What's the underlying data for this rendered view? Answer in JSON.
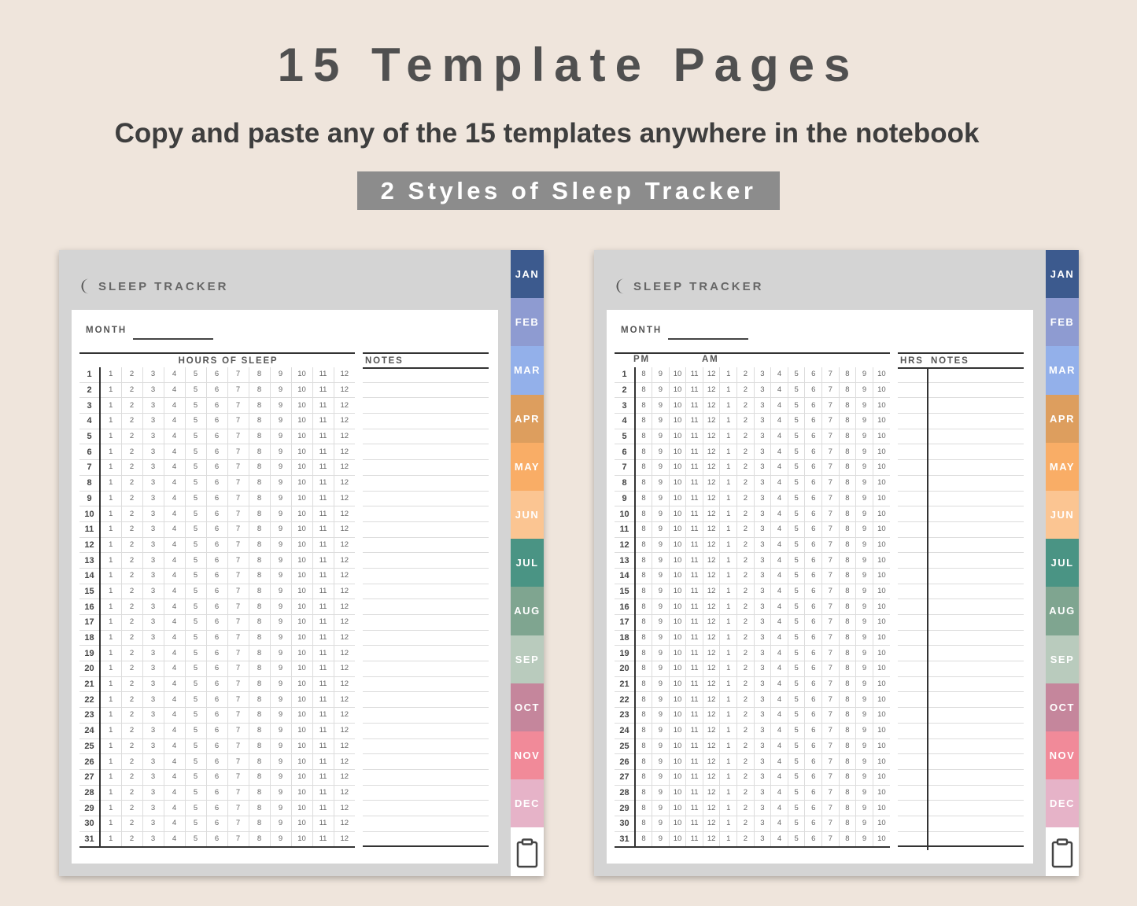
{
  "header": {
    "title": "15 Template Pages",
    "subtitle": "Copy and paste any of the 15 templates anywhere in the notebook",
    "badge": "2 Styles of Sleep Tracker"
  },
  "tracker": {
    "title": "SLEEP TRACKER",
    "month_label": "MONTH",
    "days": [
      1,
      2,
      3,
      4,
      5,
      6,
      7,
      8,
      9,
      10,
      11,
      12,
      13,
      14,
      15,
      16,
      17,
      18,
      19,
      20,
      21,
      22,
      23,
      24,
      25,
      26,
      27,
      28,
      29,
      30,
      31
    ]
  },
  "page1": {
    "grid_header": "HOURS OF SLEEP",
    "notes_header": "NOTES",
    "hours": [
      "1",
      "2",
      "3",
      "4",
      "5",
      "6",
      "7",
      "8",
      "9",
      "10",
      "11",
      "12"
    ]
  },
  "page2": {
    "pm_label": "PM",
    "am_label": "AM",
    "hrs_header": "HRS",
    "notes_header": "NOTES",
    "hours": [
      "8",
      "9",
      "10",
      "11",
      "12",
      "1",
      "2",
      "3",
      "4",
      "5",
      "6",
      "7",
      "8",
      "9",
      "10"
    ]
  },
  "tabs": [
    {
      "label": "JAN",
      "color": "#3c5a8e"
    },
    {
      "label": "FEB",
      "color": "#8e9bd1"
    },
    {
      "label": "MAR",
      "color": "#93b0ea"
    },
    {
      "label": "APR",
      "color": "#dd9e5e"
    },
    {
      "label": "MAY",
      "color": "#f9ad66"
    },
    {
      "label": "JUN",
      "color": "#fbc592"
    },
    {
      "label": "JUL",
      "color": "#4a9484"
    },
    {
      "label": "AUG",
      "color": "#7fa590"
    },
    {
      "label": "SEP",
      "color": "#b9cbbd"
    },
    {
      "label": "OCT",
      "color": "#c5869c"
    },
    {
      "label": "NOV",
      "color": "#f18a99"
    },
    {
      "label": "DEC",
      "color": "#e6b3c8"
    }
  ],
  "icons": {
    "moon": "moon-icon",
    "clipboard": "clipboard-icon"
  }
}
